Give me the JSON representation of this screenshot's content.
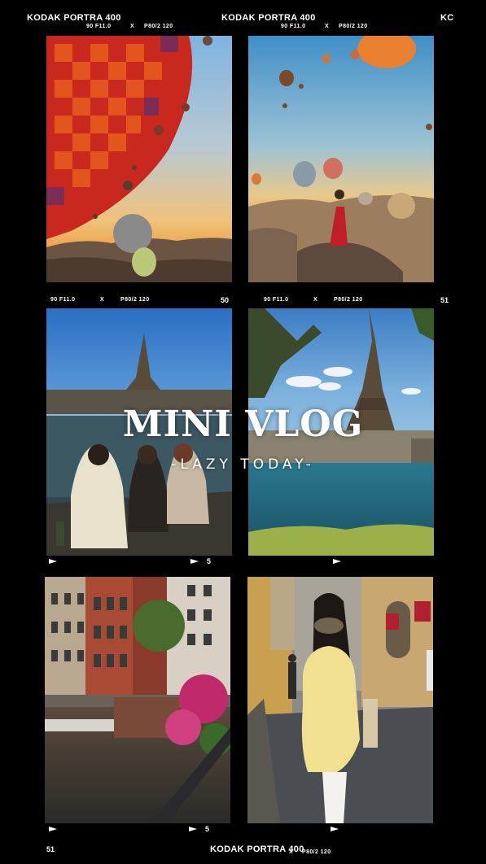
{
  "film": {
    "brand_1": "KODAK PORTRA 400",
    "brand_2": "KODAK PORTRA 400",
    "brand_3": "KODAK PORTRA 400",
    "corner": "KC",
    "left_small": "90 F11.0",
    "x_mark": "X",
    "right_small": "P80/2 120",
    "frame_50": "50",
    "frame_51": "51",
    "frame_5": "5"
  },
  "overlay": {
    "title": "MINI VLOG",
    "subtitle": "-LAZY TODAY-"
  },
  "colors": {
    "background": "#000000",
    "text": "#ffffff"
  },
  "photos": [
    {
      "name": "balloon-closeup"
    },
    {
      "name": "balloons-woman-red-dress"
    },
    {
      "name": "eiffel-tower-friends"
    },
    {
      "name": "eiffel-tower-seine"
    },
    {
      "name": "amsterdam-canal"
    },
    {
      "name": "florence-street-woman"
    }
  ]
}
